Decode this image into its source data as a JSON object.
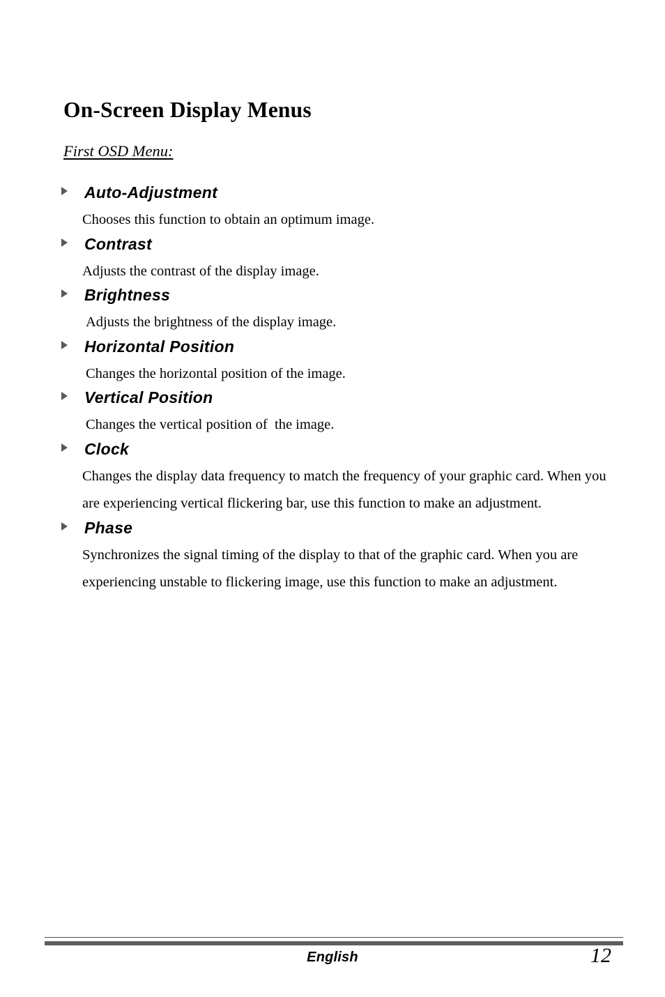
{
  "document": {
    "title": "On-Screen Display Menus",
    "section_label": "First OSD Menu:"
  },
  "menu_items": [
    {
      "icon": "triangle-right-bullet-icon",
      "heading": "Auto-Adjustment",
      "description": "Chooses this function to obtain an optimum image.",
      "indent": 0
    },
    {
      "icon": "triangle-right-bullet-icon",
      "heading": "Contrast",
      "description": "Adjusts the contrast of the display image.",
      "indent": 0
    },
    {
      "icon": "triangle-right-bullet-icon",
      "heading": "Brightness",
      "description": "Adjusts the brightness of the display image.",
      "indent": 1
    },
    {
      "icon": "triangle-right-bullet-icon",
      "heading": "Horizontal Position",
      "description": "Changes the horizontal position of the image.",
      "indent": 1
    },
    {
      "icon": "triangle-right-bullet-icon",
      "heading": "Vertical Position",
      "description": "Changes the vertical position of  the image.",
      "indent": 1
    },
    {
      "icon": "triangle-right-bullet-icon",
      "heading": "Clock",
      "description": "Changes the display data frequency to match the frequency of your graphic card. When you are experiencing vertical flickering bar, use this function to make an adjustment.",
      "indent": 0
    },
    {
      "icon": "triangle-right-bullet-icon",
      "heading": "Phase",
      "description": "Synchronizes the signal timing of the display to that of the graphic card. When you are experiencing unstable to flickering image, use this function to make an adjustment.",
      "indent": 0
    }
  ],
  "footer": {
    "language": "English",
    "page_number": "12",
    "rule_color": "#5e5e5e"
  }
}
